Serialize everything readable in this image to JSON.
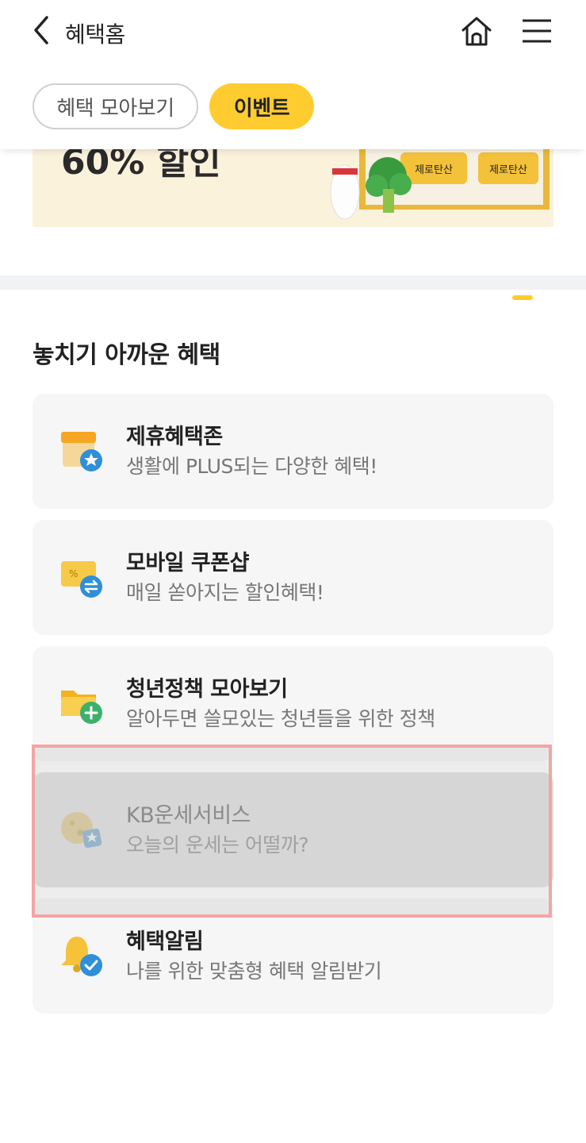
{
  "header": {
    "title": "혜택홈",
    "icons": {
      "back": "chevron-left-icon",
      "home": "home-icon",
      "menu": "hamburger-menu-icon"
    }
  },
  "tabs": [
    {
      "label": "혜택 모아보기",
      "active": false
    },
    {
      "label": "이벤트",
      "active": true
    }
  ],
  "banner": {
    "headline": "60% 할인",
    "product_label_1": "제로탄산",
    "product_label_2": "제로탄산"
  },
  "section": {
    "title": "놓치기 아까운 혜택",
    "items": [
      {
        "title": "제휴혜택존",
        "desc": "생활에 PLUS되는 다양한 혜택!",
        "icon": "store-star-icon"
      },
      {
        "title": "모바일 쿠폰샵",
        "desc": "매일 쏟아지는 할인혜택!",
        "icon": "coupon-exchange-icon"
      },
      {
        "title": "청년정책 모아보기",
        "desc": "알아두면 쓸모있는 청년들을 위한 정책",
        "icon": "folder-plus-icon"
      },
      {
        "title": "KB운세서비스",
        "desc": "오늘의 운세는 어떨까?",
        "icon": "moon-star-icon"
      },
      {
        "title": "혜택알림",
        "desc": "나를 위한 맞춤형 혜택 알림받기",
        "icon": "bell-check-icon"
      }
    ]
  },
  "colors": {
    "accent": "#ffcc2f",
    "card_bg": "#f6f6f7",
    "highlight_border": "#f4a4a4"
  }
}
